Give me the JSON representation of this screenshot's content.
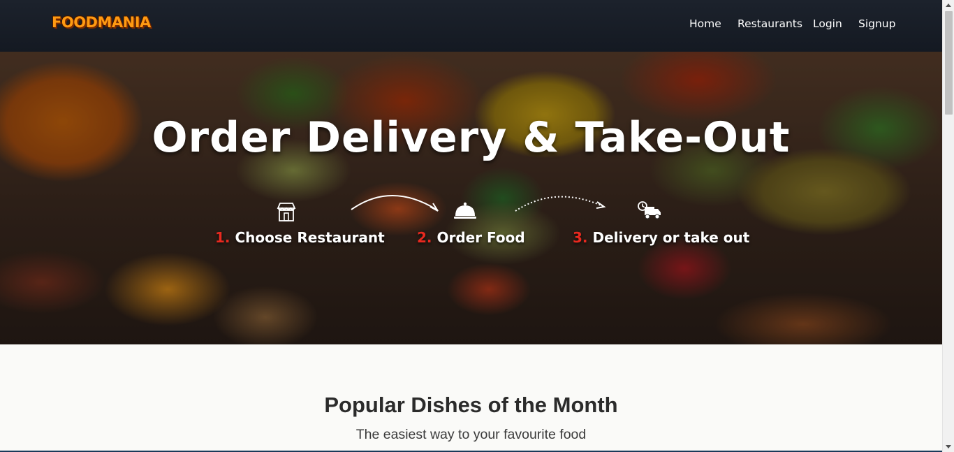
{
  "navbar": {
    "logo": "FOODMANIA",
    "links": [
      "Home",
      "Restaurants",
      "Login",
      "Signup"
    ]
  },
  "hero": {
    "title": "Order Delivery & Take-Out",
    "steps": [
      {
        "num": "1.",
        "label": "Choose Restaurant",
        "icon": "storefront-icon"
      },
      {
        "num": "2.",
        "label": "Order Food",
        "icon": "cloche-icon"
      },
      {
        "num": "3.",
        "label": "Delivery or take out",
        "icon": "delivery-truck-icon"
      }
    ]
  },
  "popular": {
    "title": "Popular Dishes of the Month",
    "subtitle": "The easiest way to your favourite food"
  },
  "colors": {
    "navbar_bg": "#1a1f28",
    "logo": "#ff9a12",
    "step_number": "#e8291f",
    "hero_text": "#ffffff"
  }
}
